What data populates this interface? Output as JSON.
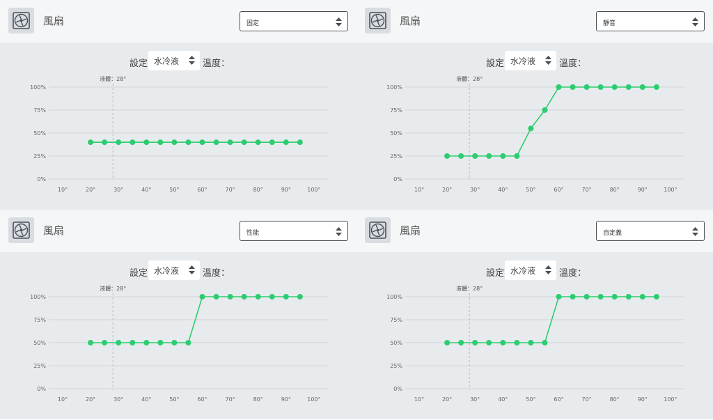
{
  "colors": {
    "header_bg": "#f5f6f8",
    "chart_bg": "#e8ebed",
    "line": "#2ecc71",
    "grid": "#d1d5d9",
    "marker_line": "#b8bcc0"
  },
  "panels": [
    {
      "title": "風扇",
      "icon": "fan-icon",
      "mode": "固定",
      "config_label": "設定",
      "source": "水冷液",
      "temp_label": "溫度：",
      "chart_data": {
        "type": "line",
        "x": [
          20,
          25,
          30,
          35,
          40,
          45,
          50,
          55,
          60,
          65,
          70,
          75,
          80,
          85,
          90,
          95
        ],
        "values": [
          40,
          40,
          40,
          40,
          40,
          40,
          40,
          40,
          40,
          40,
          40,
          40,
          40,
          40,
          40,
          40
        ],
        "xticks": [
          "10°",
          "20°",
          "30°",
          "40°",
          "50°",
          "60°",
          "70°",
          "80°",
          "90°",
          "100°"
        ],
        "yticks": [
          "100%",
          "75%",
          "50%",
          "25%",
          "0%"
        ],
        "xlim": [
          10,
          100
        ],
        "ylim": [
          0,
          100
        ],
        "grid": true,
        "marker": {
          "label": "液體：28°",
          "x": 28
        }
      }
    },
    {
      "title": "風扇",
      "icon": "fan-icon",
      "mode": "靜音",
      "config_label": "設定",
      "source": "水冷液",
      "temp_label": "溫度：",
      "chart_data": {
        "type": "line",
        "x": [
          20,
          25,
          30,
          35,
          40,
          45,
          50,
          55,
          60,
          65,
          70,
          75,
          80,
          85,
          90,
          95
        ],
        "values": [
          25,
          25,
          25,
          25,
          25,
          25,
          55,
          75,
          100,
          100,
          100,
          100,
          100,
          100,
          100,
          100
        ],
        "xticks": [
          "10°",
          "20°",
          "30°",
          "40°",
          "50°",
          "60°",
          "70°",
          "80°",
          "90°",
          "100°"
        ],
        "yticks": [
          "100%",
          "75%",
          "50%",
          "25%",
          "0%"
        ],
        "xlim": [
          10,
          100
        ],
        "ylim": [
          0,
          100
        ],
        "grid": true,
        "marker": {
          "label": "液體：28°",
          "x": 28
        }
      }
    },
    {
      "title": "風扇",
      "icon": "fan-icon",
      "mode": "性能",
      "config_label": "設定",
      "source": "水冷液",
      "temp_label": "溫度：",
      "chart_data": {
        "type": "line",
        "x": [
          20,
          25,
          30,
          35,
          40,
          45,
          50,
          55,
          60,
          65,
          70,
          75,
          80,
          85,
          90,
          95
        ],
        "values": [
          50,
          50,
          50,
          50,
          50,
          50,
          50,
          50,
          100,
          100,
          100,
          100,
          100,
          100,
          100,
          100
        ],
        "xticks": [
          "10°",
          "20°",
          "30°",
          "40°",
          "50°",
          "60°",
          "70°",
          "80°",
          "90°",
          "100°"
        ],
        "yticks": [
          "100%",
          "75%",
          "50%",
          "25%",
          "0%"
        ],
        "xlim": [
          10,
          100
        ],
        "ylim": [
          0,
          100
        ],
        "grid": true,
        "marker": {
          "label": "液體：28°",
          "x": 28
        }
      }
    },
    {
      "title": "風扇",
      "icon": "fan-icon",
      "mode": "自定義",
      "config_label": "設定",
      "source": "水冷液",
      "temp_label": "溫度：",
      "chart_data": {
        "type": "line",
        "x": [
          20,
          25,
          30,
          35,
          40,
          45,
          50,
          55,
          60,
          65,
          70,
          75,
          80,
          85,
          90,
          95
        ],
        "values": [
          50,
          50,
          50,
          50,
          50,
          50,
          50,
          50,
          100,
          100,
          100,
          100,
          100,
          100,
          100,
          100
        ],
        "xticks": [
          "10°",
          "20°",
          "30°",
          "40°",
          "50°",
          "60°",
          "70°",
          "80°",
          "90°",
          "100°"
        ],
        "yticks": [
          "100%",
          "75%",
          "50%",
          "25%",
          "0%"
        ],
        "xlim": [
          10,
          100
        ],
        "ylim": [
          0,
          100
        ],
        "grid": true,
        "marker": {
          "label": "液體：28°",
          "x": 28
        }
      }
    }
  ]
}
